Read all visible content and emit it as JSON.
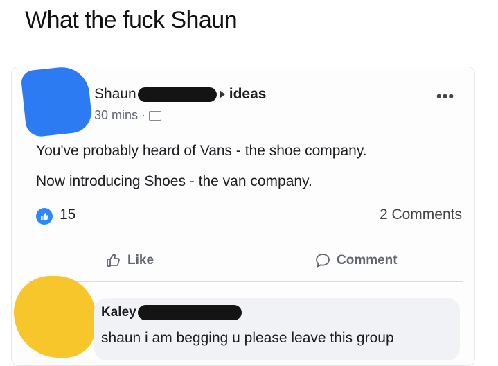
{
  "caption": "What the fuck Shaun",
  "post": {
    "author": "Shaun",
    "group": "ideas",
    "time": "30 mins ·",
    "menu": "•••",
    "lines": [
      "You've probably heard of Vans - the shoe company.",
      "Now introducing Shoes - the van company."
    ],
    "like_count": "15",
    "comment_count": "2 Comments"
  },
  "actions": {
    "like": "Like",
    "comment": "Comment"
  },
  "comment": {
    "author": "Kaley",
    "text": "shaun i am begging u please leave this group"
  },
  "colors": {
    "brand_blue": "#2d88ff",
    "avatar_blue": "#2c7bf2",
    "avatar_yellow": "#f6c62a"
  }
}
